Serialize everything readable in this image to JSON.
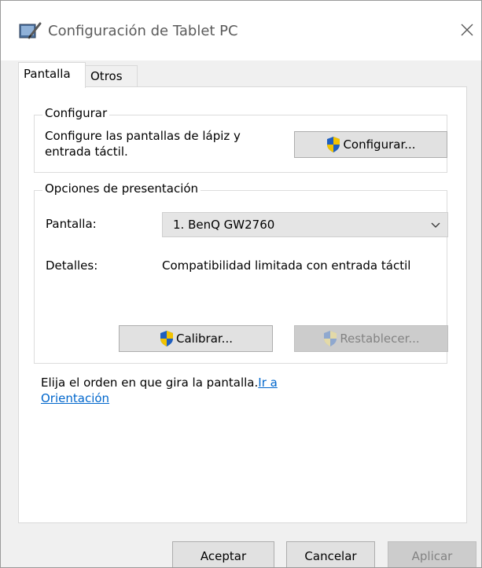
{
  "window": {
    "title": "Configuración de Tablet PC",
    "icon": "tablet-pc-settings-icon",
    "close_icon": "close-icon"
  },
  "tabs": [
    {
      "label": "Pantalla",
      "active": true
    },
    {
      "label": "Otros",
      "active": false
    }
  ],
  "configure_group": {
    "legend": "Configurar",
    "description_line1": "Configure las pantallas de lápiz y",
    "description_line2": "entrada táctil.",
    "button_label": "Configurar...",
    "button_icon": "uac-shield-icon"
  },
  "display_options_group": {
    "legend": "Opciones de presentación",
    "display_label": "Pantalla:",
    "display_value": "1. BenQ GW2760",
    "details_label": "Detalles:",
    "details_value": "Compatibilidad limitada con entrada táctil",
    "calibrate_label": "Calibrar...",
    "reset_label": "Restablecer...",
    "reset_enabled": false
  },
  "orientation": {
    "text": "Elija el orden en que gira la pantalla.",
    "link_part1": "Ir a",
    "link_part2": "Orientación"
  },
  "footer": {
    "ok_label": "Aceptar",
    "cancel_label": "Cancelar",
    "apply_label": "Aplicar",
    "apply_enabled": false
  },
  "colors": {
    "link": "#0066cc",
    "shield_blue": "#1f5fbf",
    "shield_yellow": "#f2c300",
    "disabled_text": "#838383"
  }
}
